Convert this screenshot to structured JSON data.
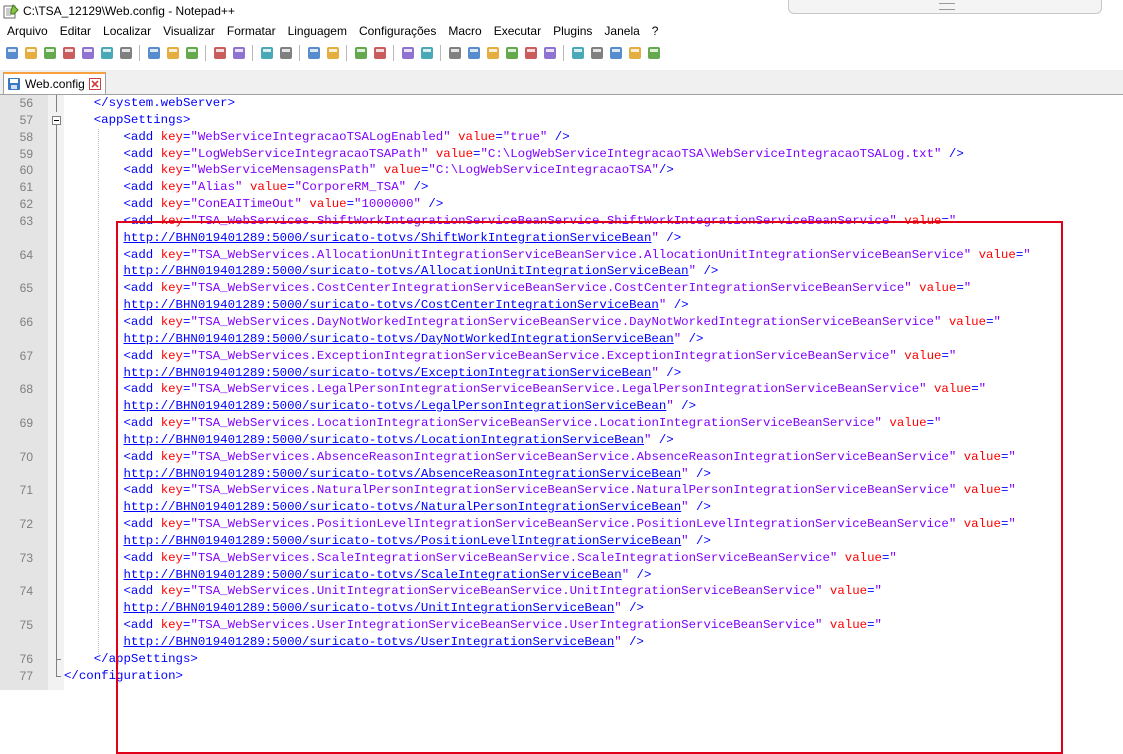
{
  "window": {
    "title": "C:\\TSA_12129\\Web.config - Notepad++"
  },
  "menu": [
    "Arquivo",
    "Editar",
    "Localizar",
    "Visualizar",
    "Formatar",
    "Linguagem",
    "Configurações",
    "Macro",
    "Executar",
    "Plugins",
    "Janela",
    "?"
  ],
  "toolbar_icons": [
    "new-file-icon",
    "open-file-icon",
    "save-icon",
    "save-all-icon",
    "close-icon",
    "close-all-icon",
    "print-icon",
    "sep",
    "cut-icon",
    "copy-icon",
    "paste-icon",
    "sep",
    "undo-icon",
    "redo-icon",
    "sep",
    "find-icon",
    "replace-icon",
    "sep",
    "zoom-in-icon",
    "zoom-out-icon",
    "sep",
    "sync-vertical-icon",
    "sync-horizontal-icon",
    "sep",
    "word-wrap-icon",
    "show-all-chars-icon",
    "sep",
    "indent-guide-icon",
    "user-lang-icon",
    "doc-map-icon",
    "function-list-icon",
    "folder-workspace-icon",
    "monitoring-icon",
    "sep",
    "record-macro-icon",
    "stop-macro-icon",
    "play-macro-icon",
    "run-macro-multiple-icon",
    "save-macro-icon"
  ],
  "tab": {
    "label": "Web.config",
    "accent": "#f9a03f"
  },
  "colors": {
    "tag": "#0000ff",
    "attr": "#ff0000",
    "string": "#8000ff",
    "highlight_box": "#e0001a"
  },
  "lines": [
    {
      "n": "56",
      "fold": "line",
      "segments": [
        [
          "p",
          "    "
        ],
        [
          "tag",
          "</system.webServer>"
        ]
      ]
    },
    {
      "n": "57",
      "fold": "minus",
      "segments": [
        [
          "p",
          "    "
        ],
        [
          "tag",
          "<appSettings>"
        ]
      ]
    },
    {
      "n": "58",
      "fold": "line",
      "segments": [
        [
          "p",
          "        "
        ],
        [
          "tag",
          "<add "
        ],
        [
          "attr",
          "key"
        ],
        [
          "tag",
          "="
        ],
        [
          "str",
          "\"WebServiceIntegracaoTSALogEnabled\""
        ],
        [
          "tag",
          " "
        ],
        [
          "attr",
          "value"
        ],
        [
          "tag",
          "="
        ],
        [
          "str",
          "\"true\""
        ],
        [
          "tag",
          " />"
        ]
      ]
    },
    {
      "n": "59",
      "fold": "line",
      "segments": [
        [
          "p",
          "        "
        ],
        [
          "tag",
          "<add "
        ],
        [
          "attr",
          "key"
        ],
        [
          "tag",
          "="
        ],
        [
          "str",
          "\"LogWebServiceIntegracaoTSAPath\""
        ],
        [
          "tag",
          " "
        ],
        [
          "attr",
          "value"
        ],
        [
          "tag",
          "="
        ],
        [
          "str",
          "\"C:\\LogWebServiceIntegracaoTSA\\WebServiceIntegracaoTSALog.txt\""
        ],
        [
          "tag",
          " />"
        ]
      ]
    },
    {
      "n": "60",
      "fold": "line",
      "segments": [
        [
          "p",
          "        "
        ],
        [
          "tag",
          "<add "
        ],
        [
          "attr",
          "key"
        ],
        [
          "tag",
          "="
        ],
        [
          "str",
          "\"WebServiceMensagensPath\""
        ],
        [
          "tag",
          " "
        ],
        [
          "attr",
          "value"
        ],
        [
          "tag",
          "="
        ],
        [
          "str",
          "\"C:\\LogWebServiceIntegracaoTSA\""
        ],
        [
          "tag",
          "/>"
        ]
      ]
    },
    {
      "n": "61",
      "fold": "line",
      "segments": [
        [
          "p",
          "        "
        ],
        [
          "tag",
          "<add "
        ],
        [
          "attr",
          "key"
        ],
        [
          "tag",
          "="
        ],
        [
          "str",
          "\"Alias\""
        ],
        [
          "tag",
          " "
        ],
        [
          "attr",
          "value"
        ],
        [
          "tag",
          "="
        ],
        [
          "str",
          "\"CorporeRM_TSA\""
        ],
        [
          "tag",
          " />"
        ]
      ]
    },
    {
      "n": "62",
      "fold": "line",
      "segments": [
        [
          "p",
          "        "
        ],
        [
          "tag",
          "<add "
        ],
        [
          "attr",
          "key"
        ],
        [
          "tag",
          "="
        ],
        [
          "str",
          "\"ConEAITimeOut\""
        ],
        [
          "tag",
          " "
        ],
        [
          "attr",
          "value"
        ],
        [
          "tag",
          "="
        ],
        [
          "str",
          "\"1000000\""
        ],
        [
          "tag",
          " />"
        ]
      ]
    },
    {
      "n": "63",
      "fold": "line",
      "segments": [
        [
          "p",
          "        "
        ],
        [
          "tag",
          "<add "
        ],
        [
          "attr",
          "key"
        ],
        [
          "tag",
          "="
        ],
        [
          "str",
          "\"TSA_WebServices.ShiftWorkIntegrationServiceBeanService.ShiftWorkIntegrationServiceBeanService\""
        ],
        [
          "tag",
          " "
        ],
        [
          "attr",
          "value"
        ],
        [
          "tag",
          "="
        ],
        [
          "str",
          "\""
        ]
      ]
    },
    {
      "n": "",
      "fold": "line",
      "segments": [
        [
          "p",
          "        "
        ],
        [
          "url",
          "http://BHN019401289:5000/suricato-totvs/ShiftWorkIntegrationServiceBean"
        ],
        [
          "str",
          "\""
        ],
        [
          "tag",
          " />"
        ]
      ]
    },
    {
      "n": "64",
      "fold": "line",
      "segments": [
        [
          "p",
          "        "
        ],
        [
          "tag",
          "<add "
        ],
        [
          "attr",
          "key"
        ],
        [
          "tag",
          "="
        ],
        [
          "str",
          "\"TSA_WebServices.AllocationUnitIntegrationServiceBeanService.AllocationUnitIntegrationServiceBeanService\""
        ],
        [
          "tag",
          " "
        ],
        [
          "attr",
          "value"
        ],
        [
          "tag",
          "="
        ],
        [
          "str",
          "\""
        ]
      ]
    },
    {
      "n": "",
      "fold": "line",
      "segments": [
        [
          "p",
          "        "
        ],
        [
          "url",
          "http://BHN019401289:5000/suricato-totvs/AllocationUnitIntegrationServiceBean"
        ],
        [
          "str",
          "\""
        ],
        [
          "tag",
          " />"
        ]
      ]
    },
    {
      "n": "65",
      "fold": "line",
      "segments": [
        [
          "p",
          "        "
        ],
        [
          "tag",
          "<add "
        ],
        [
          "attr",
          "key"
        ],
        [
          "tag",
          "="
        ],
        [
          "str",
          "\"TSA_WebServices.CostCenterIntegrationServiceBeanService.CostCenterIntegrationServiceBeanService\""
        ],
        [
          "tag",
          " "
        ],
        [
          "attr",
          "value"
        ],
        [
          "tag",
          "="
        ],
        [
          "str",
          "\""
        ]
      ]
    },
    {
      "n": "",
      "fold": "line",
      "segments": [
        [
          "p",
          "        "
        ],
        [
          "url",
          "http://BHN019401289:5000/suricato-totvs/CostCenterIntegrationServiceBean"
        ],
        [
          "str",
          "\""
        ],
        [
          "tag",
          " />"
        ]
      ]
    },
    {
      "n": "66",
      "fold": "line",
      "segments": [
        [
          "p",
          "        "
        ],
        [
          "tag",
          "<add "
        ],
        [
          "attr",
          "key"
        ],
        [
          "tag",
          "="
        ],
        [
          "str",
          "\"TSA_WebServices.DayNotWorkedIntegrationServiceBeanService.DayNotWorkedIntegrationServiceBeanService\""
        ],
        [
          "tag",
          " "
        ],
        [
          "attr",
          "value"
        ],
        [
          "tag",
          "="
        ],
        [
          "str",
          "\""
        ]
      ]
    },
    {
      "n": "",
      "fold": "line",
      "segments": [
        [
          "p",
          "        "
        ],
        [
          "url",
          "http://BHN019401289:5000/suricato-totvs/DayNotWorkedIntegrationServiceBean"
        ],
        [
          "str",
          "\""
        ],
        [
          "tag",
          " />"
        ]
      ]
    },
    {
      "n": "67",
      "fold": "line",
      "segments": [
        [
          "p",
          "        "
        ],
        [
          "tag",
          "<add "
        ],
        [
          "attr",
          "key"
        ],
        [
          "tag",
          "="
        ],
        [
          "str",
          "\"TSA_WebServices.ExceptionIntegrationServiceBeanService.ExceptionIntegrationServiceBeanService\""
        ],
        [
          "tag",
          " "
        ],
        [
          "attr",
          "value"
        ],
        [
          "tag",
          "="
        ],
        [
          "str",
          "\""
        ]
      ]
    },
    {
      "n": "",
      "fold": "line",
      "segments": [
        [
          "p",
          "        "
        ],
        [
          "url",
          "http://BHN019401289:5000/suricato-totvs/ExceptionIntegrationServiceBean"
        ],
        [
          "str",
          "\""
        ],
        [
          "tag",
          " />"
        ]
      ]
    },
    {
      "n": "68",
      "fold": "line",
      "segments": [
        [
          "p",
          "        "
        ],
        [
          "tag",
          "<add "
        ],
        [
          "attr",
          "key"
        ],
        [
          "tag",
          "="
        ],
        [
          "str",
          "\"TSA_WebServices.LegalPersonIntegrationServiceBeanService.LegalPersonIntegrationServiceBeanService\""
        ],
        [
          "tag",
          " "
        ],
        [
          "attr",
          "value"
        ],
        [
          "tag",
          "="
        ],
        [
          "str",
          "\""
        ]
      ]
    },
    {
      "n": "",
      "fold": "line",
      "segments": [
        [
          "p",
          "        "
        ],
        [
          "url",
          "http://BHN019401289:5000/suricato-totvs/LegalPersonIntegrationServiceBean"
        ],
        [
          "str",
          "\""
        ],
        [
          "tag",
          " />"
        ]
      ]
    },
    {
      "n": "69",
      "fold": "line",
      "segments": [
        [
          "p",
          "        "
        ],
        [
          "tag",
          "<add "
        ],
        [
          "attr",
          "key"
        ],
        [
          "tag",
          "="
        ],
        [
          "str",
          "\"TSA_WebServices.LocationIntegrationServiceBeanService.LocationIntegrationServiceBeanService\""
        ],
        [
          "tag",
          " "
        ],
        [
          "attr",
          "value"
        ],
        [
          "tag",
          "="
        ],
        [
          "str",
          "\""
        ]
      ]
    },
    {
      "n": "",
      "fold": "line",
      "segments": [
        [
          "p",
          "        "
        ],
        [
          "url",
          "http://BHN019401289:5000/suricato-totvs/LocationIntegrationServiceBean"
        ],
        [
          "str",
          "\""
        ],
        [
          "tag",
          " />"
        ]
      ]
    },
    {
      "n": "70",
      "fold": "line",
      "segments": [
        [
          "p",
          "        "
        ],
        [
          "tag",
          "<add "
        ],
        [
          "attr",
          "key"
        ],
        [
          "tag",
          "="
        ],
        [
          "str",
          "\"TSA_WebServices.AbsenceReasonIntegrationServiceBeanService.AbsenceReasonIntegrationServiceBeanService\""
        ],
        [
          "tag",
          " "
        ],
        [
          "attr",
          "value"
        ],
        [
          "tag",
          "="
        ],
        [
          "str",
          "\""
        ]
      ]
    },
    {
      "n": "",
      "fold": "line",
      "segments": [
        [
          "p",
          "        "
        ],
        [
          "url",
          "http://BHN019401289:5000/suricato-totvs/AbsenceReasonIntegrationServiceBean"
        ],
        [
          "str",
          "\""
        ],
        [
          "tag",
          " />"
        ]
      ]
    },
    {
      "n": "71",
      "fold": "line",
      "segments": [
        [
          "p",
          "        "
        ],
        [
          "tag",
          "<add "
        ],
        [
          "attr",
          "key"
        ],
        [
          "tag",
          "="
        ],
        [
          "str",
          "\"TSA_WebServices.NaturalPersonIntegrationServiceBeanService.NaturalPersonIntegrationServiceBeanService\""
        ],
        [
          "tag",
          " "
        ],
        [
          "attr",
          "value"
        ],
        [
          "tag",
          "="
        ],
        [
          "str",
          "\""
        ]
      ]
    },
    {
      "n": "",
      "fold": "line",
      "segments": [
        [
          "p",
          "        "
        ],
        [
          "url",
          "http://BHN019401289:5000/suricato-totvs/NaturalPersonIntegrationServiceBean"
        ],
        [
          "str",
          "\""
        ],
        [
          "tag",
          " />"
        ]
      ]
    },
    {
      "n": "72",
      "fold": "line",
      "segments": [
        [
          "p",
          "        "
        ],
        [
          "tag",
          "<add "
        ],
        [
          "attr",
          "key"
        ],
        [
          "tag",
          "="
        ],
        [
          "str",
          "\"TSA_WebServices.PositionLevelIntegrationServiceBeanService.PositionLevelIntegrationServiceBeanService\""
        ],
        [
          "tag",
          " "
        ],
        [
          "attr",
          "value"
        ],
        [
          "tag",
          "="
        ],
        [
          "str",
          "\""
        ]
      ]
    },
    {
      "n": "",
      "fold": "line",
      "segments": [
        [
          "p",
          "        "
        ],
        [
          "url",
          "http://BHN019401289:5000/suricato-totvs/PositionLevelIntegrationServiceBean"
        ],
        [
          "str",
          "\""
        ],
        [
          "tag",
          " />"
        ]
      ]
    },
    {
      "n": "73",
      "fold": "line",
      "segments": [
        [
          "p",
          "        "
        ],
        [
          "tag",
          "<add "
        ],
        [
          "attr",
          "key"
        ],
        [
          "tag",
          "="
        ],
        [
          "str",
          "\"TSA_WebServices.ScaleIntegrationServiceBeanService.ScaleIntegrationServiceBeanService\""
        ],
        [
          "tag",
          " "
        ],
        [
          "attr",
          "value"
        ],
        [
          "tag",
          "="
        ],
        [
          "str",
          "\""
        ]
      ]
    },
    {
      "n": "",
      "fold": "line",
      "segments": [
        [
          "p",
          "        "
        ],
        [
          "url",
          "http://BHN019401289:5000/suricato-totvs/ScaleIntegrationServiceBean"
        ],
        [
          "str",
          "\""
        ],
        [
          "tag",
          " />"
        ]
      ]
    },
    {
      "n": "74",
      "fold": "line",
      "segments": [
        [
          "p",
          "        "
        ],
        [
          "tag",
          "<add "
        ],
        [
          "attr",
          "key"
        ],
        [
          "tag",
          "="
        ],
        [
          "str",
          "\"TSA_WebServices.UnitIntegrationServiceBeanService.UnitIntegrationServiceBeanService\""
        ],
        [
          "tag",
          " "
        ],
        [
          "attr",
          "value"
        ],
        [
          "tag",
          "="
        ],
        [
          "str",
          "\""
        ]
      ]
    },
    {
      "n": "",
      "fold": "line",
      "segments": [
        [
          "p",
          "        "
        ],
        [
          "url",
          "http://BHN019401289:5000/suricato-totvs/UnitIntegrationServiceBean"
        ],
        [
          "str",
          "\""
        ],
        [
          "tag",
          " />"
        ]
      ]
    },
    {
      "n": "75",
      "fold": "line",
      "segments": [
        [
          "p",
          "        "
        ],
        [
          "tag",
          "<add "
        ],
        [
          "attr",
          "key"
        ],
        [
          "tag",
          "="
        ],
        [
          "str",
          "\"TSA_WebServices.UserIntegrationServiceBeanService.UserIntegrationServiceBeanService\""
        ],
        [
          "tag",
          " "
        ],
        [
          "attr",
          "value"
        ],
        [
          "tag",
          "="
        ],
        [
          "str",
          "\""
        ]
      ]
    },
    {
      "n": "",
      "fold": "line",
      "segments": [
        [
          "p",
          "        "
        ],
        [
          "url",
          "http://BHN019401289:5000/suricato-totvs/UserIntegrationServiceBean"
        ],
        [
          "str",
          "\""
        ],
        [
          "tag",
          " />"
        ]
      ]
    },
    {
      "n": "76",
      "fold": "end",
      "segments": [
        [
          "p",
          "    "
        ],
        [
          "tag",
          "</appSettings>"
        ]
      ]
    },
    {
      "n": "77",
      "fold": "end0",
      "segments": [
        [
          "tag",
          "</configuration>"
        ]
      ]
    }
  ]
}
